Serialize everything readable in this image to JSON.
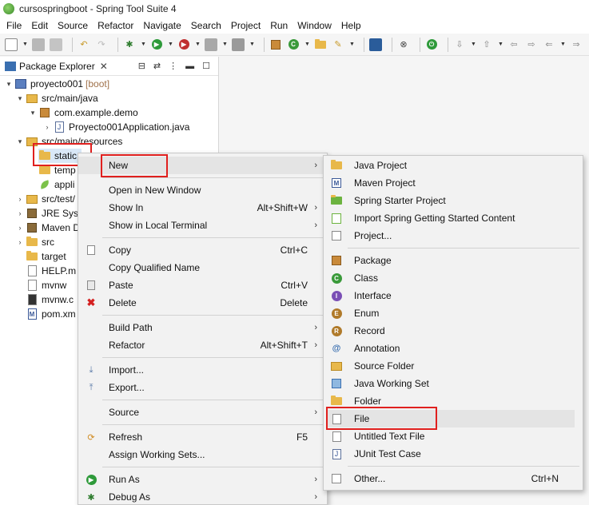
{
  "window": {
    "title": "cursospringboot - Spring Tool Suite 4"
  },
  "menubar": [
    "File",
    "Edit",
    "Source",
    "Refactor",
    "Navigate",
    "Search",
    "Project",
    "Run",
    "Window",
    "Help"
  ],
  "explorer": {
    "tab_label": "Package Explorer",
    "tab_close": "✕",
    "tree": [
      {
        "label": "proyecto001",
        "decoration": "[boot]"
      },
      {
        "label": "src/main/java"
      },
      {
        "label": "com.example.demo"
      },
      {
        "label": "Proyecto001Application.java"
      },
      {
        "label": "src/main/resources"
      },
      {
        "label": "static"
      },
      {
        "label": "temp"
      },
      {
        "label": "appli"
      },
      {
        "label": "src/test/"
      },
      {
        "label": "JRE Syst"
      },
      {
        "label": "Maven D"
      },
      {
        "label": "src"
      },
      {
        "label": "target"
      },
      {
        "label": "HELP.m"
      },
      {
        "label": "mvnw"
      },
      {
        "label": "mvnw.c"
      },
      {
        "label": "pom.xm"
      }
    ]
  },
  "context_menu": {
    "items": [
      {
        "label": "New"
      },
      {
        "label": "Open in New Window"
      },
      {
        "label": "Show In",
        "accelerator": "Alt+Shift+W"
      },
      {
        "label": "Show in Local Terminal"
      },
      {
        "label": "Copy",
        "accelerator": "Ctrl+C"
      },
      {
        "label": "Copy Qualified Name"
      },
      {
        "label": "Paste",
        "accelerator": "Ctrl+V"
      },
      {
        "label": "Delete",
        "accelerator": "Delete"
      },
      {
        "label": "Build Path"
      },
      {
        "label": "Refactor",
        "accelerator": "Alt+Shift+T"
      },
      {
        "label": "Import..."
      },
      {
        "label": "Export..."
      },
      {
        "label": "Source"
      },
      {
        "label": "Refresh",
        "accelerator": "F5"
      },
      {
        "label": "Assign Working Sets..."
      },
      {
        "label": "Run As"
      },
      {
        "label": "Debug As"
      }
    ]
  },
  "submenu": {
    "items": [
      {
        "label": "Java Project"
      },
      {
        "label": "Maven Project"
      },
      {
        "label": "Spring Starter Project"
      },
      {
        "label": "Import Spring Getting Started Content"
      },
      {
        "label": "Project..."
      },
      {
        "label": "Package"
      },
      {
        "label": "Class"
      },
      {
        "label": "Interface"
      },
      {
        "label": "Enum"
      },
      {
        "label": "Record"
      },
      {
        "label": "Annotation"
      },
      {
        "label": "Source Folder"
      },
      {
        "label": "Java Working Set"
      },
      {
        "label": "Folder"
      },
      {
        "label": "File"
      },
      {
        "label": "Untitled Text File"
      },
      {
        "label": "JUnit Test Case"
      },
      {
        "label": "Other...",
        "accelerator": "Ctrl+N"
      }
    ]
  },
  "colors": {
    "highlight": "#e0201e",
    "selection": "#d9e8f7",
    "menu_bg": "#f2f2f2"
  },
  "icons": [
    "spring-logo-icon",
    "folder-icon",
    "package-icon",
    "java-file-icon",
    "class-icon",
    "interface-icon",
    "enum-icon",
    "record-icon",
    "annotation-icon",
    "run-icon",
    "debug-icon",
    "refresh-icon",
    "delete-icon"
  ]
}
